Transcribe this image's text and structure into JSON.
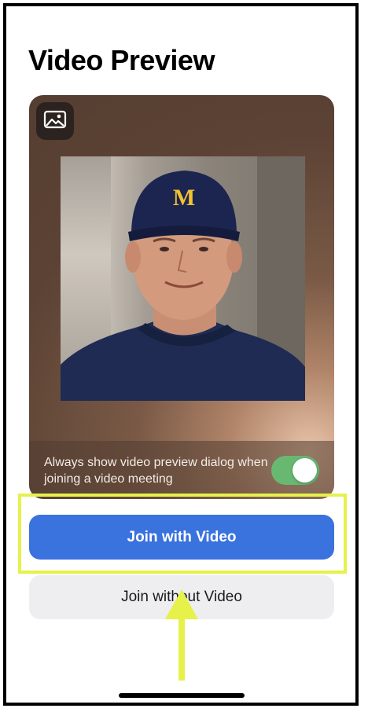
{
  "header": {
    "title": "Video Preview"
  },
  "preview": {
    "background_icon": "image-icon",
    "toggle_label": "Always show video preview dialog when joining a video meeting",
    "toggle_on": true,
    "toggle_color": "#68b871"
  },
  "actions": {
    "join_with_video": "Join with Video",
    "join_without_video": "Join without Video",
    "primary_color": "#3a72de"
  },
  "annotation": {
    "highlight_color": "#e6f24a",
    "arrow_icon": "arrow-up-icon"
  },
  "cap_logo": "M"
}
